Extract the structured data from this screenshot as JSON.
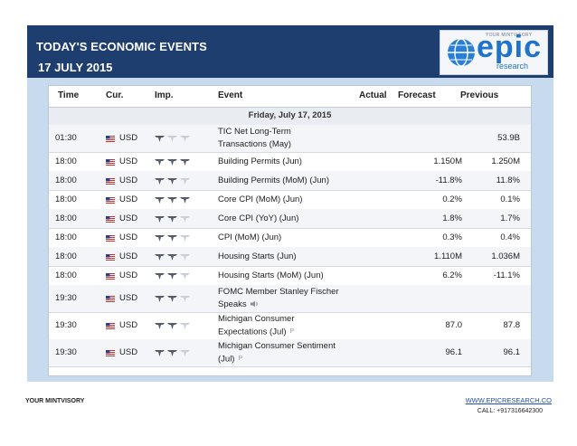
{
  "header": {
    "title": "TODAY'S ECONOMIC EVENTS",
    "date": "17 JULY 2015",
    "logo_top": "YOUR MINTVISORY",
    "logo_text": "epic",
    "logo_sub": "research"
  },
  "table": {
    "columns": [
      "Time",
      "Cur.",
      "Imp.",
      "Event",
      "Actual",
      "Forecast",
      "Previous"
    ],
    "day_label": "Friday, July 17, 2015",
    "rows": [
      {
        "time": "01:30",
        "currency": "USD",
        "impact": 1,
        "event": [
          "TIC Net Long-Term",
          "Transactions (May)"
        ],
        "actual": "",
        "forecast": "",
        "previous": "53.9B",
        "extra": ""
      },
      {
        "time": "18:00",
        "currency": "USD",
        "impact": 3,
        "event": [
          "Building Permits (Jun)"
        ],
        "actual": "",
        "forecast": "1.150M",
        "previous": "1.250M",
        "extra": ""
      },
      {
        "time": "18:00",
        "currency": "USD",
        "impact": 2,
        "event": [
          "Building Permits (MoM) (Jun)"
        ],
        "actual": "",
        "forecast": "-11.8%",
        "previous": "11.8%",
        "extra": ""
      },
      {
        "time": "18:00",
        "currency": "USD",
        "impact": 3,
        "event": [
          "Core CPI (MoM) (Jun)"
        ],
        "actual": "",
        "forecast": "0.2%",
        "previous": "0.1%",
        "extra": ""
      },
      {
        "time": "18:00",
        "currency": "USD",
        "impact": 2,
        "event": [
          "Core CPI (YoY) (Jun)"
        ],
        "actual": "",
        "forecast": "1.8%",
        "previous": "1.7%",
        "extra": ""
      },
      {
        "time": "18:00",
        "currency": "USD",
        "impact": 2,
        "event": [
          "CPI (MoM) (Jun)"
        ],
        "actual": "",
        "forecast": "0.3%",
        "previous": "0.4%",
        "extra": ""
      },
      {
        "time": "18:00",
        "currency": "USD",
        "impact": 2,
        "event": [
          "Housing Starts (Jun)"
        ],
        "actual": "",
        "forecast": "1.110M",
        "previous": "1.036M",
        "extra": ""
      },
      {
        "time": "18:00",
        "currency": "USD",
        "impact": 2,
        "event": [
          "Housing Starts (MoM) (Jun)"
        ],
        "actual": "",
        "forecast": "6.2%",
        "previous": "-11.1%",
        "extra": ""
      },
      {
        "time": "19:30",
        "currency": "USD",
        "impact": 2,
        "event": [
          "FOMC Member Stanley Fischer",
          "Speaks"
        ],
        "actual": "",
        "forecast": "",
        "previous": "",
        "extra": "speaker"
      },
      {
        "time": "19:30",
        "currency": "USD",
        "impact": 2,
        "event": [
          "Michigan Consumer",
          "Expectations (Jul)"
        ],
        "actual": "",
        "forecast": "87.0",
        "previous": "87.8",
        "extra": "prelim"
      },
      {
        "time": "19:30",
        "currency": "USD",
        "impact": 2,
        "event": [
          "Michigan Consumer Sentiment",
          "(Jul)"
        ],
        "actual": "",
        "forecast": "96.1",
        "previous": "96.1",
        "extra": "prelim"
      }
    ]
  },
  "footer": {
    "left": "YOUR MINTVISORY",
    "website": "WWW.EPICRESEARCH.CO",
    "call": "CALL: +917316642300"
  },
  "colors": {
    "header_bg": "#1f3e70",
    "panel_bg": "#c8dbee",
    "accent": "#1f73c9"
  }
}
